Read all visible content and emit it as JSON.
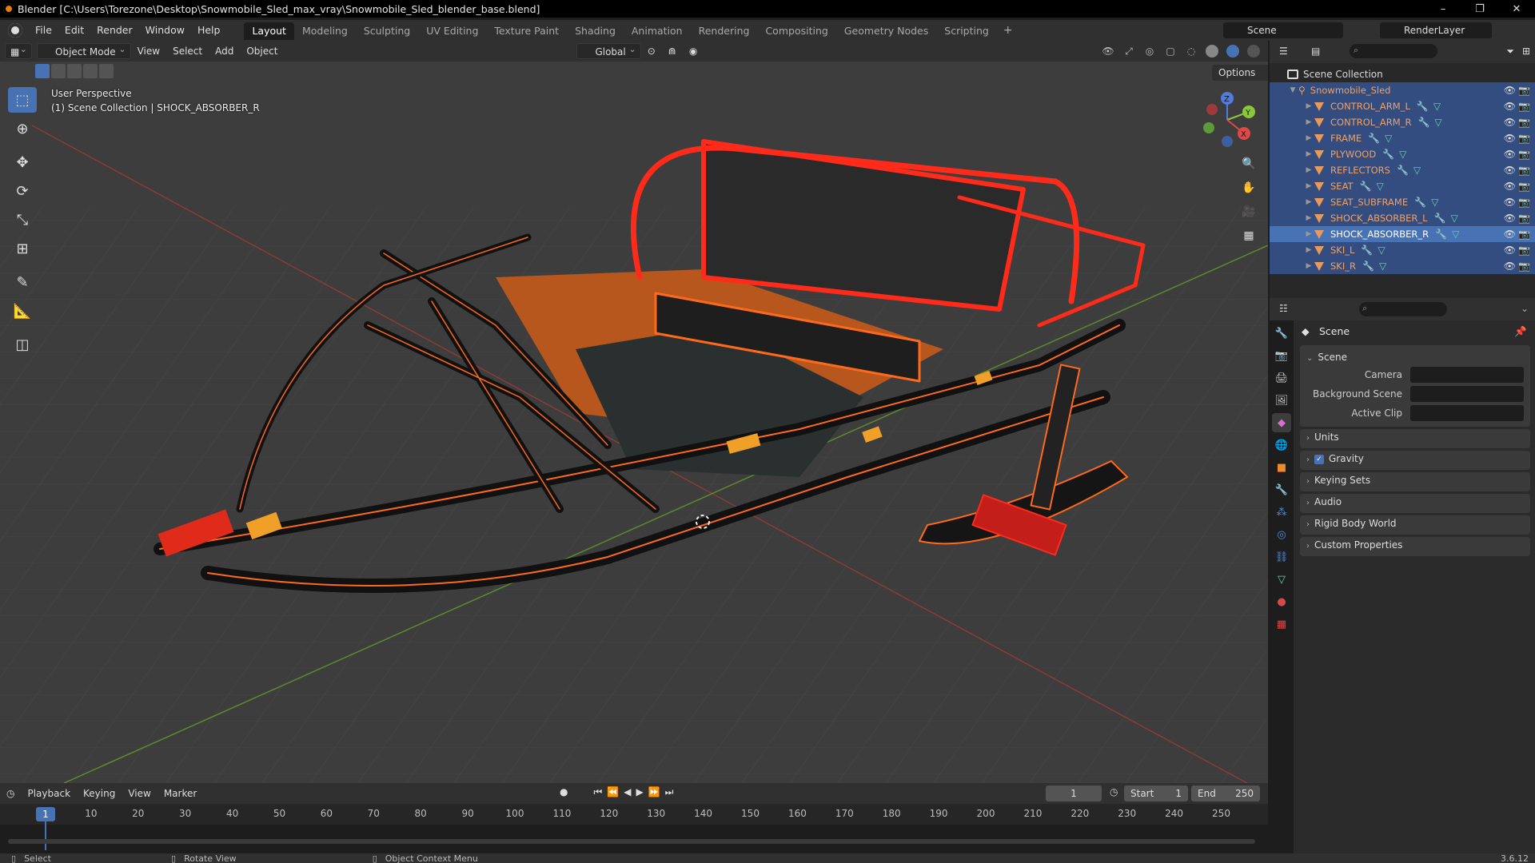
{
  "window": {
    "title": "Blender [C:\\Users\\Torezone\\Desktop\\Snowmobile_Sled_max_vray\\Snowmobile_Sled_blender_base.blend]",
    "minimize": "–",
    "maximize": "❐",
    "close": "✕"
  },
  "menubar": {
    "menus": [
      "File",
      "Edit",
      "Render",
      "Window",
      "Help"
    ],
    "workspaces": [
      "Layout",
      "Modeling",
      "Sculpting",
      "UV Editing",
      "Texture Paint",
      "Shading",
      "Animation",
      "Rendering",
      "Compositing",
      "Geometry Nodes",
      "Scripting"
    ],
    "active_workspace": "Layout",
    "add_tab": "+",
    "scene_name": "Scene",
    "view_layer": "RenderLayer"
  },
  "viewport_header": {
    "mode": "Object Mode",
    "menus": [
      "View",
      "Select",
      "Add",
      "Object"
    ],
    "orientation": "Global",
    "options": "Options"
  },
  "viewport": {
    "view_name": "User Perspective",
    "context_text": "(1) Scene Collection | SHOCK_ABSORBER_R",
    "gizmo": {
      "z": "Z",
      "y": "Y",
      "x": "X"
    },
    "colors": {
      "grid": "#444444",
      "x_axis": "#8a3b3b",
      "y_axis": "#5e8a2f",
      "selection": "#ff6a1a",
      "active": "#ff2b1a"
    }
  },
  "timeline": {
    "menus": [
      "Playback",
      "Keying",
      "View",
      "Marker"
    ],
    "current_frame": "1",
    "start_label": "Start",
    "start": "1",
    "end_label": "End",
    "end": "250",
    "ticks": [
      "10",
      "20",
      "30",
      "40",
      "50",
      "60",
      "70",
      "80",
      "90",
      "100",
      "110",
      "120",
      "130",
      "140",
      "150",
      "160",
      "170",
      "180",
      "190",
      "200",
      "210",
      "220",
      "230",
      "240",
      "250"
    ],
    "marker": "1"
  },
  "statusbar": {
    "select": "Select",
    "rotate": "Rotate View",
    "context_menu": "Object Context Menu",
    "version": "3.6.12"
  },
  "outliner": {
    "root": "Scene Collection",
    "collection": "Snowmobile_Sled",
    "objects": [
      "CONTROL_ARM_L",
      "CONTROL_ARM_R",
      "FRAME",
      "PLYWOOD",
      "REFLECTORS",
      "SEAT",
      "SEAT_SUBFRAME",
      "SHOCK_ABSORBER_L",
      "SHOCK_ABSORBER_R",
      "SKI_L",
      "SKI_R"
    ],
    "active_object": "SHOCK_ABSORBER_R"
  },
  "properties": {
    "context": "Scene",
    "panel_title": "Scene",
    "camera_label": "Camera",
    "background_scene_label": "Background Scene",
    "active_clip_label": "Active Clip",
    "collapsed_panels": [
      "Units",
      "Gravity",
      "Keying Sets",
      "Audio",
      "Rigid Body World",
      "Custom Properties"
    ]
  }
}
